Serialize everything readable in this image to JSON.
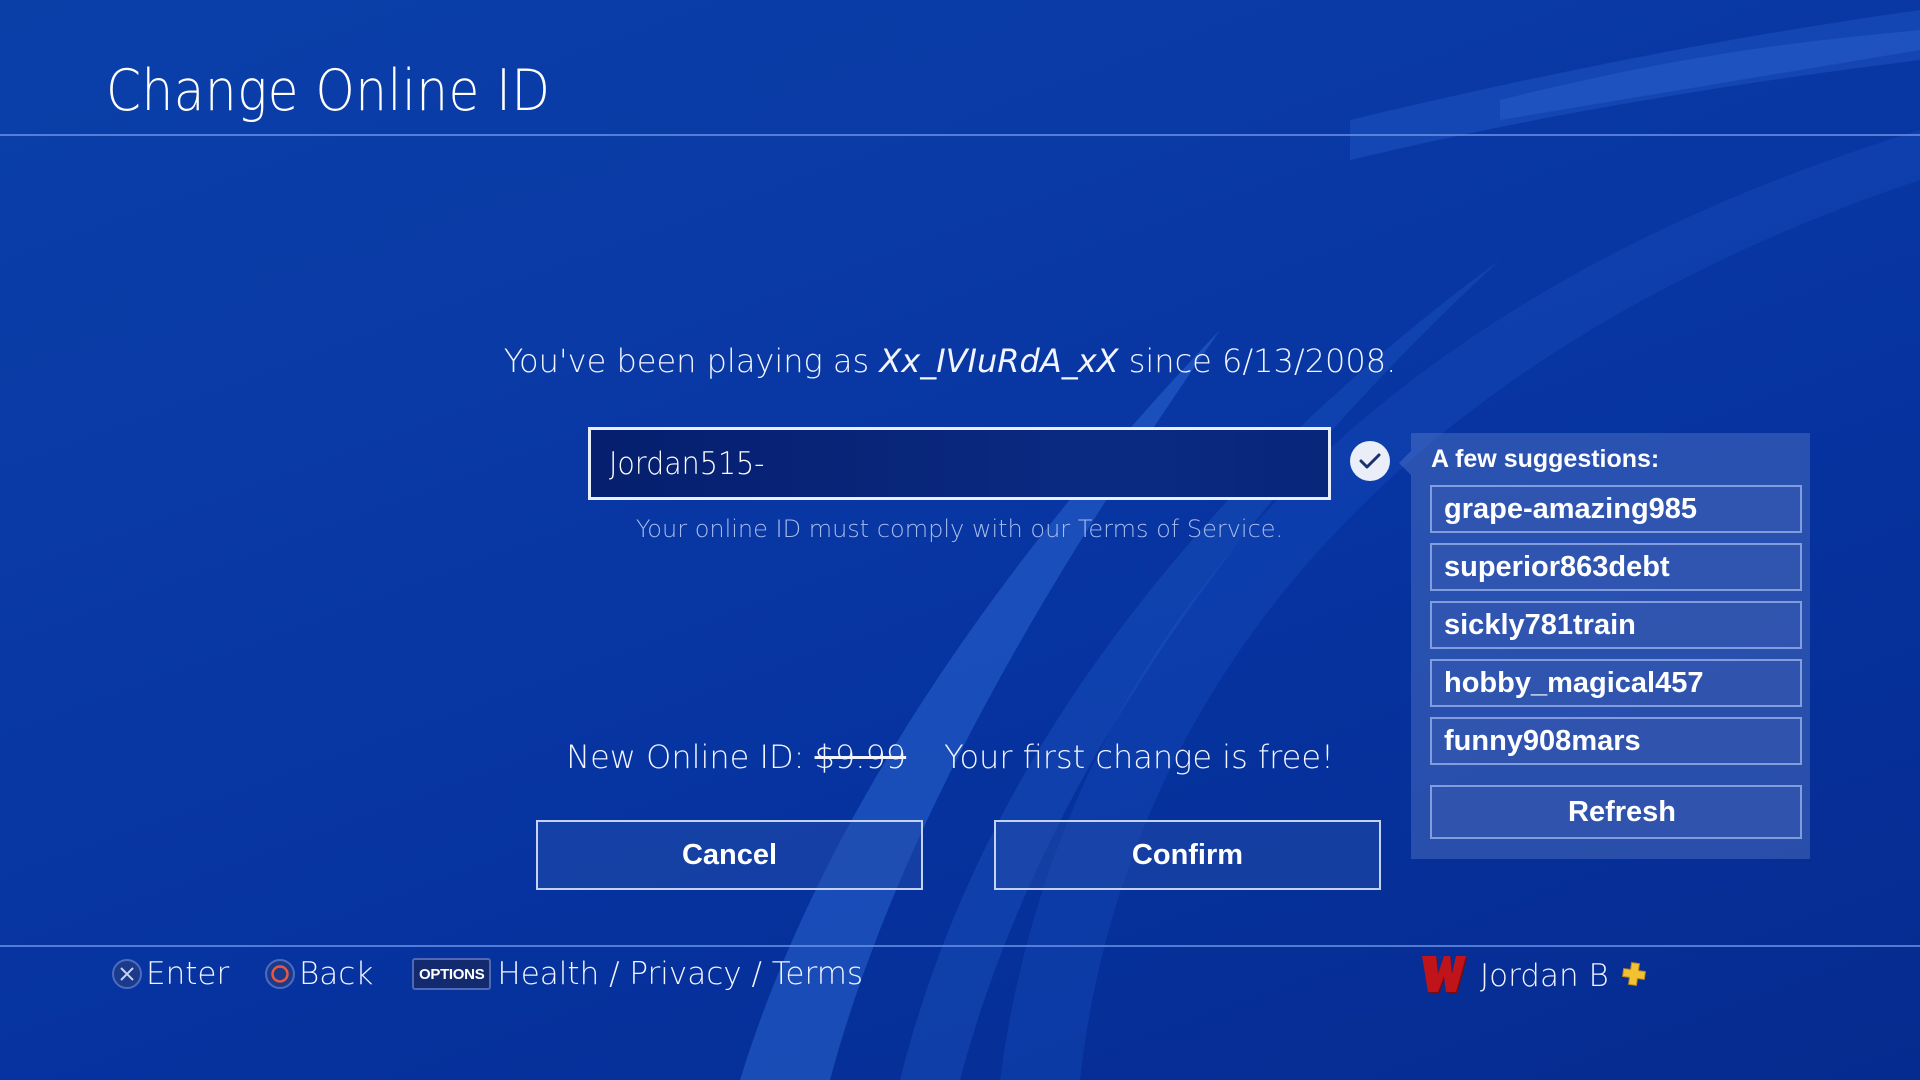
{
  "header": {
    "title": "Change Online ID"
  },
  "main": {
    "playing_prefix": "You've been playing as ",
    "current_id": "Xx_IVIuRdA_xX",
    "playing_suffix": " since 6/13/2008.",
    "input_value": "Jordan515-",
    "availability_icon": "checkmark-icon",
    "tos_note": "Your online ID must comply with our Terms of Service.",
    "price_label": "New Online ID: ",
    "price_original": "$9.99",
    "free_note": "Your first change is free!",
    "cancel_label": "Cancel",
    "confirm_label": "Confirm"
  },
  "suggestions": {
    "title": "A few suggestions:",
    "items": [
      "grape-amazing985",
      "superior863debt",
      "sickly781train",
      "hobby_magical457",
      "funny908mars"
    ],
    "refresh_label": "Refresh"
  },
  "footer": {
    "hints": [
      {
        "icon": "cross-button-icon",
        "label": "Enter"
      },
      {
        "icon": "circle-button-icon",
        "label": "Back"
      },
      {
        "icon": "options-button-icon",
        "glyph_text": "OPTIONS",
        "label": "Health / Privacy / Terms"
      }
    ],
    "user": {
      "avatar": "wisconsin-w-avatar",
      "name": "Jordan B",
      "badge": "playstation-plus-icon"
    }
  },
  "colors": {
    "background": "#0a3aa6",
    "accent_circle": "#e8583c",
    "plus_gold": "#f2c230",
    "avatar_red": "#c0141a"
  }
}
